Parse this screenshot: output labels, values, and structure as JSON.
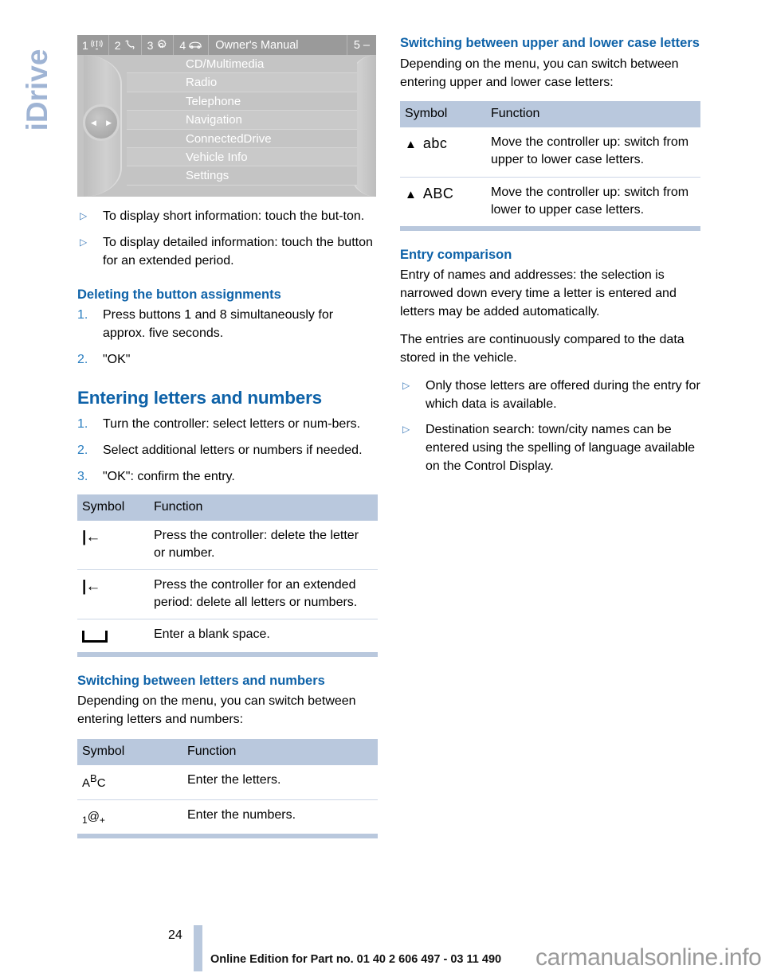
{
  "chapter_tab": {
    "label": "iDrive"
  },
  "idrive_display": {
    "topbar": {
      "items": [
        {
          "number": "1",
          "icon": "radio-antenna-icon"
        },
        {
          "number": "2",
          "icon": "telephone-handset-icon"
        },
        {
          "number": "3",
          "icon": "gear-icon"
        },
        {
          "number": "4",
          "icon": "car-front-icon"
        }
      ],
      "title": "Owner's Manual",
      "right_label": "5 –"
    },
    "knob": {
      "left_arrow": "◀",
      "right_arrow": "▶"
    },
    "menu_items": [
      "CD/Multimedia",
      "Radio",
      "Telephone",
      "Navigation",
      "ConnectedDrive",
      "Vehicle Info",
      "Settings"
    ]
  },
  "left_column": {
    "intro_bullets": [
      "To display short information: touch the but-ton.",
      "To display detailed information: touch the button for an extended period."
    ],
    "deleting": {
      "heading": "Deleting the button assignments",
      "steps": [
        {
          "num": "1.",
          "text": "Press buttons 1 and 8 simultaneously for approx. five seconds."
        },
        {
          "num": "2.",
          "text": "\"OK\""
        }
      ]
    },
    "entering": {
      "heading": "Entering letters and numbers",
      "steps": [
        {
          "num": "1.",
          "text": "Turn the controller: select letters or num-bers."
        },
        {
          "num": "2.",
          "text": "Select additional letters or numbers if needed."
        },
        {
          "num": "3.",
          "text": "\"OK\": confirm the entry."
        }
      ],
      "table": {
        "headers": {
          "symbol": "Symbol",
          "function": "Function"
        },
        "rows": [
          {
            "symbol": "|←",
            "symbol_name": "backspace-icon",
            "function": "Press the controller: delete the letter or number."
          },
          {
            "symbol": "|←",
            "symbol_name": "backspace-icon",
            "function": "Press the controller for an extended period: delete all letters or numbers."
          },
          {
            "symbol": "⌴",
            "symbol_name": "space-bar-icon",
            "function": "Enter a blank space."
          }
        ]
      }
    },
    "switching_letters_numbers": {
      "heading": "Switching between letters and numbers",
      "intro": "Depending on the menu, you can switch between entering letters and numbers:",
      "table": {
        "headers": {
          "symbol": "Symbol",
          "function": "Function"
        },
        "rows": [
          {
            "symbol_main": "A",
            "symbol_sup": "B",
            "symbol_tail": "C",
            "symbol_name": "abc-letters-icon",
            "function": "Enter the letters."
          },
          {
            "symbol_main": "1",
            "symbol_sup": "@",
            "symbol_tail": "+",
            "symbol_name": "numbers-symbols-icon",
            "function": "Enter the numbers."
          }
        ]
      }
    }
  },
  "right_column": {
    "switching_case": {
      "heading": "Switching between upper and lower case letters",
      "intro": "Depending on the menu, you can switch between entering upper and lower case letters:",
      "table": {
        "headers": {
          "symbol": "Symbol",
          "function": "Function"
        },
        "rows": [
          {
            "triangle": "▲",
            "label": "abc",
            "symbol_name": "controller-up-lowercase-icon",
            "function": "Move the controller up: switch from upper to lower case letters."
          },
          {
            "triangle": "▲",
            "label": "ABC",
            "symbol_name": "controller-up-uppercase-icon",
            "function": "Move the controller up: switch from lower to upper case letters."
          }
        ]
      }
    },
    "entry_comparison": {
      "heading": "Entry comparison",
      "paragraphs": [
        "Entry of names and addresses: the selection is narrowed down every time a letter is entered and letters may be added automatically.",
        "The entries are continuously compared to the data stored in the vehicle."
      ],
      "bullets": [
        "Only those letters are offered during the entry for which data is available.",
        "Destination search: town/city names can be entered using the spelling of language available on the Control Display."
      ]
    }
  },
  "footer": {
    "page_number": "24",
    "edition_text": "Online Edition for Part no. 01 40 2 606 497 - 03 11 490",
    "watermark": "carmanualsonline.info"
  },
  "colors": {
    "heading_blue": "#0e62a8",
    "accent_blue": "#2a7ec0",
    "table_header": "#b9c8dd",
    "tab_blue": "#9fb4d4"
  }
}
